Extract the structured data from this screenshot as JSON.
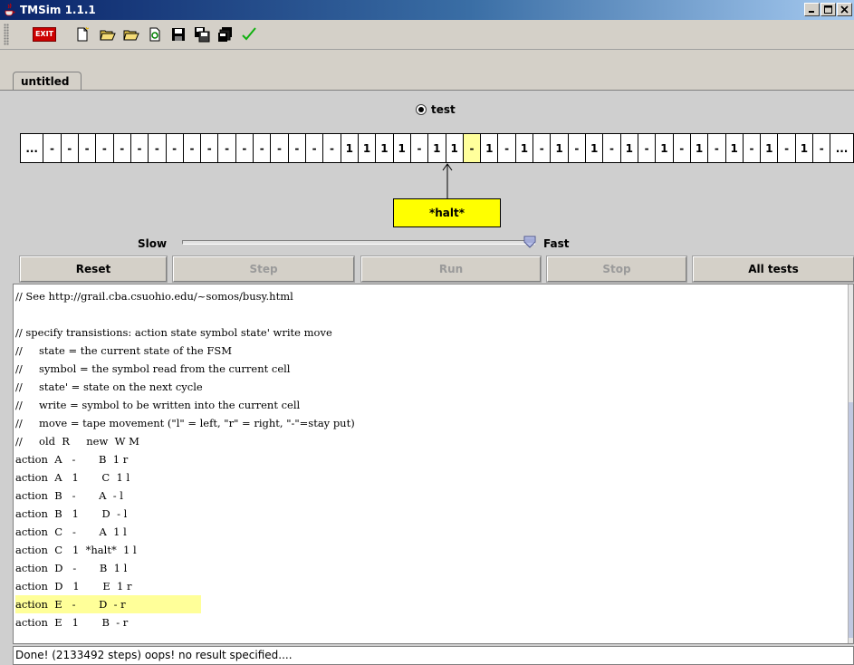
{
  "window": {
    "title": "TMSim 1.1.1"
  },
  "toolbar": {
    "exit_label": "EXIT",
    "icons": [
      "new-file-icon",
      "open-folder-icon",
      "open-folder-alt-icon",
      "reload-icon",
      "save-icon",
      "save-as-icon",
      "save-all-icon",
      "checkmark-icon"
    ]
  },
  "tabs": [
    {
      "label": "untitled"
    }
  ],
  "test_radio": {
    "label": "test",
    "selected": true
  },
  "tape": {
    "cells": [
      "...",
      "-",
      "-",
      "-",
      "-",
      "-",
      "-",
      "-",
      "-",
      "-",
      "-",
      "-",
      "-",
      "-",
      "-",
      "-",
      "-",
      "-",
      "1",
      "1",
      "1",
      "1",
      "-",
      "1",
      "1",
      "-",
      "1",
      "-",
      "1",
      "-",
      "1",
      "-",
      "1",
      "-",
      "1",
      "-",
      "1",
      "-",
      "1",
      "-",
      "1",
      "-",
      "1",
      "-",
      "1",
      "-",
      "..."
    ],
    "head_index": 25,
    "head_color": "#ffff9c"
  },
  "state": {
    "label": "*halt*",
    "color": "#ffff00"
  },
  "speed": {
    "slow_label": "Slow",
    "fast_label": "Fast",
    "value": 1.0
  },
  "buttons": {
    "reset": "Reset",
    "step": "Step",
    "run": "Run",
    "stop": "Stop",
    "all_tests": "All tests"
  },
  "editor": {
    "lines": [
      "// See http://grail.cba.csuohio.edu/~somos/busy.html",
      "",
      "// specify transistions: action state symbol state' write move",
      "//     state = the current state of the FSM",
      "//     symbol = the symbol read from the current cell",
      "//     state' = state on the next cycle",
      "//     write = symbol to be written into the current cell",
      "//     move = tape movement (\"l\" = left, \"r\" = right, \"-\"=stay put)",
      "//     old  R     new  W M",
      "action  A   -       B  1 r",
      "action  A   1       C  1 l",
      "action  B   -       A  - l",
      "action  B   1       D  - l",
      "action  C   -       A  1 l",
      "action  C   1  *halt*  1 l",
      "action  D   -       B  1 l",
      "action  D   1       E  1 r",
      "action  E   -       D  - r",
      "action  E   1       B  - r"
    ],
    "highlight_line": 17,
    "highlight_color": "#ffff99"
  },
  "status": {
    "text": "Done! (2133492 steps) oops! no result specified...."
  }
}
